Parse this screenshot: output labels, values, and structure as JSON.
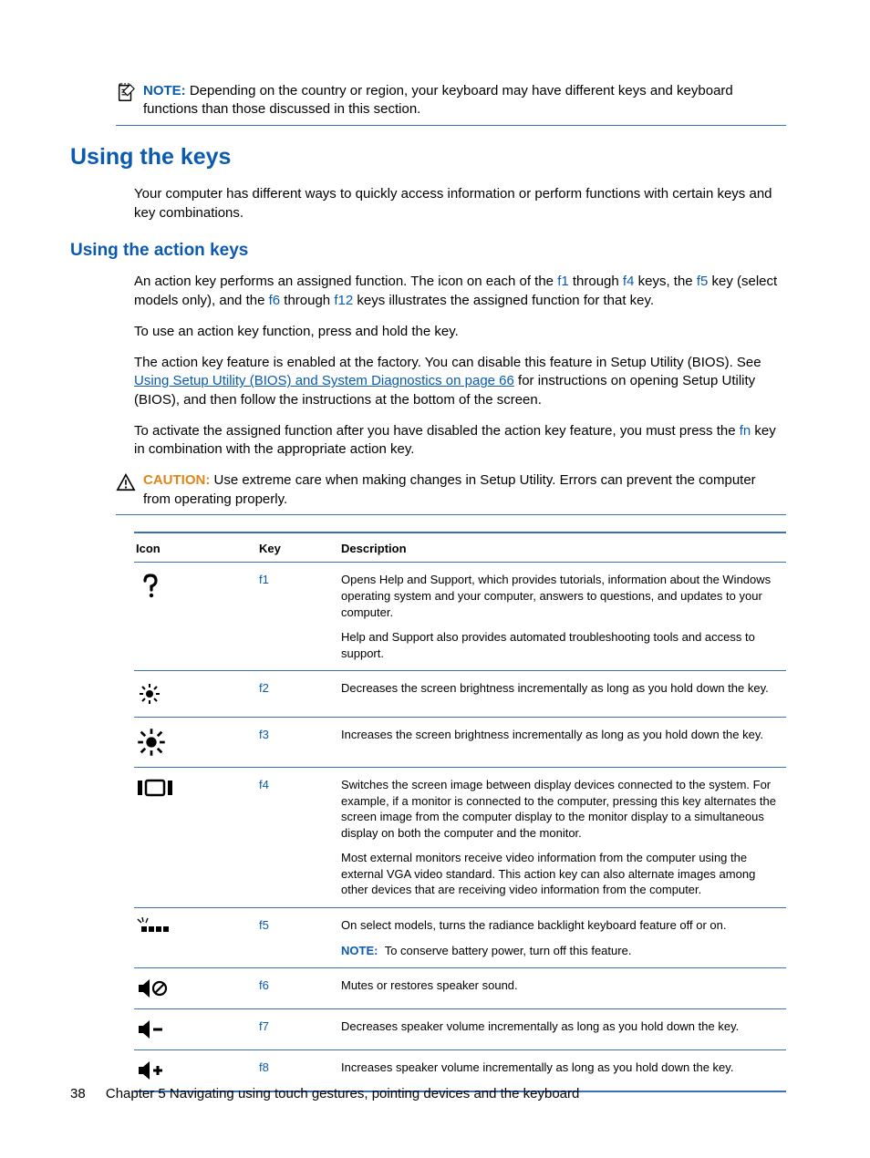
{
  "topNote": {
    "label": "NOTE:",
    "text": "Depending on the country or region, your keyboard may have different keys and keyboard functions than those discussed in this section."
  },
  "h2": "Using the keys",
  "intro": "Your computer has different ways to quickly access information or perform functions with certain keys and key combinations.",
  "h3": "Using the action keys",
  "p1a": "An action key performs an assigned function. The icon on each of the ",
  "f1": "f1",
  "p1b": " through ",
  "f4": "f4",
  "p1c": " keys, the ",
  "f5": "f5",
  "p1d": " key (select models only), and the ",
  "f6": "f6",
  "p1e": " through ",
  "f12": "f12",
  "p1f": " keys illustrates the assigned function for that key.",
  "p2": "To use an action key function, press and hold the key.",
  "p3a": "The action key feature is enabled at the factory. You can disable this feature in Setup Utility (BIOS). See ",
  "p3link": "Using Setup Utility (BIOS) and System Diagnostics on page 66",
  "p3b": " for instructions on opening Setup Utility (BIOS), and then follow the instructions at the bottom of the screen.",
  "p4a": "To activate the assigned function after you have disabled the action key feature, you must press the ",
  "fn": "fn",
  "p4b": " key in combination with the appropriate action key.",
  "caution": {
    "label": "CAUTION:",
    "text": "Use extreme care when making changes in Setup Utility. Errors can prevent the computer from operating properly."
  },
  "table": {
    "headers": {
      "icon": "Icon",
      "key": "Key",
      "desc": "Description"
    },
    "rows": [
      {
        "key": "f1",
        "desc1": "Opens Help and Support, which provides tutorials, information about the Windows operating system and your computer, answers to questions, and updates to your computer.",
        "desc2": "Help and Support also provides automated troubleshooting tools and access to support."
      },
      {
        "key": "f2",
        "desc1": "Decreases the screen brightness incrementally as long as you hold down the key."
      },
      {
        "key": "f3",
        "desc1": "Increases the screen brightness incrementally as long as you hold down the key."
      },
      {
        "key": "f4",
        "desc1": "Switches the screen image between display devices connected to the system. For example, if a monitor is connected to the computer, pressing this key alternates the screen image from the computer display to the monitor display to a simultaneous display on both the computer and the monitor.",
        "desc2": "Most external monitors receive video information from the computer using the external VGA video standard. This action key can also alternate images among other devices that are receiving video information from the computer."
      },
      {
        "key": "f5",
        "desc1": "On select models, turns the radiance backlight keyboard feature off or on.",
        "noteLabel": "NOTE:",
        "noteText": "To conserve battery power, turn off this feature."
      },
      {
        "key": "f6",
        "desc1": "Mutes or restores speaker sound."
      },
      {
        "key": "f7",
        "desc1": "Decreases speaker volume incrementally as long as you hold down the key."
      },
      {
        "key": "f8",
        "desc1": "Increases speaker volume incrementally as long as you hold down the key."
      }
    ]
  },
  "footer": {
    "page": "38",
    "chapter": "Chapter 5   Navigating using touch gestures, pointing devices and the keyboard"
  }
}
